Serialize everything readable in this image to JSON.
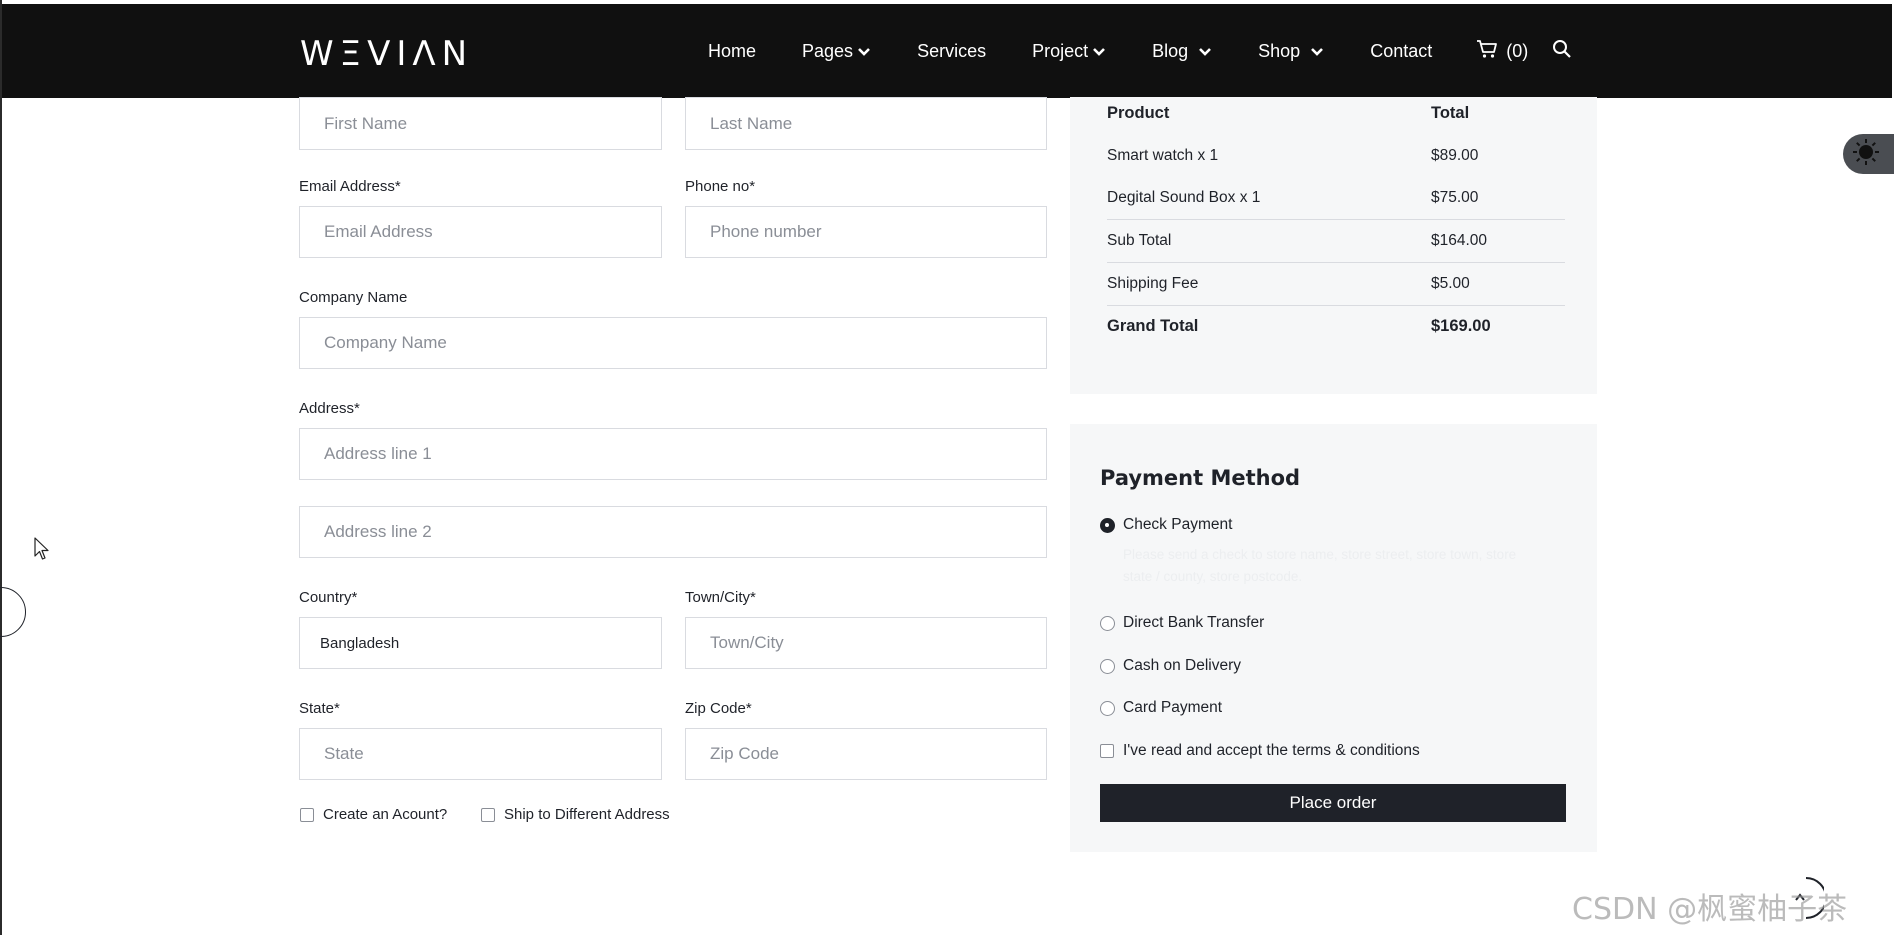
{
  "header": {
    "logo": "WΞVIΛN",
    "nav": [
      {
        "label": "Home"
      },
      {
        "label": "Pages"
      },
      {
        "label": "Services"
      },
      {
        "label": "Project"
      },
      {
        "label": "Blog"
      },
      {
        "label": "Shop"
      },
      {
        "label": "Contact"
      }
    ],
    "cart_count": "(0)"
  },
  "form": {
    "first_name_placeholder": "First Name",
    "last_name_placeholder": "Last Name",
    "email_label": "Email Address*",
    "email_placeholder": "Email Address",
    "phone_label": "Phone no*",
    "phone_placeholder": "Phone number",
    "company_label": "Company Name",
    "company_placeholder": "Company Name",
    "address_label": "Address*",
    "address1_placeholder": "Address line 1",
    "address2_placeholder": "Address line 2",
    "country_label": "Country*",
    "country_value": "Bangladesh",
    "town_label": "Town/City*",
    "town_placeholder": "Town/City",
    "state_label": "State*",
    "state_placeholder": "State",
    "zip_label": "Zip Code*",
    "zip_placeholder": "Zip Code",
    "create_account_label": "Create an Acount?",
    "ship_different_label": "Ship to Different Address"
  },
  "summary": {
    "header_product": "Product",
    "header_total": "Total",
    "rows": [
      {
        "name": "Smart watch x 1",
        "total": "$89.00"
      },
      {
        "name": "Degital Sound Box x 1",
        "total": "$75.00"
      },
      {
        "name": "Sub Total",
        "total": "$164.00"
      },
      {
        "name": "Shipping Fee",
        "total": "$5.00"
      }
    ],
    "grand_label": "Grand Total",
    "grand_total": "$169.00"
  },
  "payment": {
    "title": "Payment Method",
    "options": [
      {
        "label": "Check Payment",
        "selected": true
      },
      {
        "label": "Direct Bank Transfer",
        "selected": false
      },
      {
        "label": "Cash on Delivery",
        "selected": false
      },
      {
        "label": "Card Payment",
        "selected": false
      }
    ],
    "description": "Please send a check to store name, store street, store town, store state / county, store postcode.",
    "terms_label": "I've read and accept the terms & conditions",
    "button_label": "Place order"
  },
  "watermark": "CSDN @枫蜜柚子茶",
  "colors": {
    "header_bg": "#101010",
    "panel_bg": "#f6f7f8",
    "button_bg": "#1f2229",
    "text": "#1f2229"
  }
}
